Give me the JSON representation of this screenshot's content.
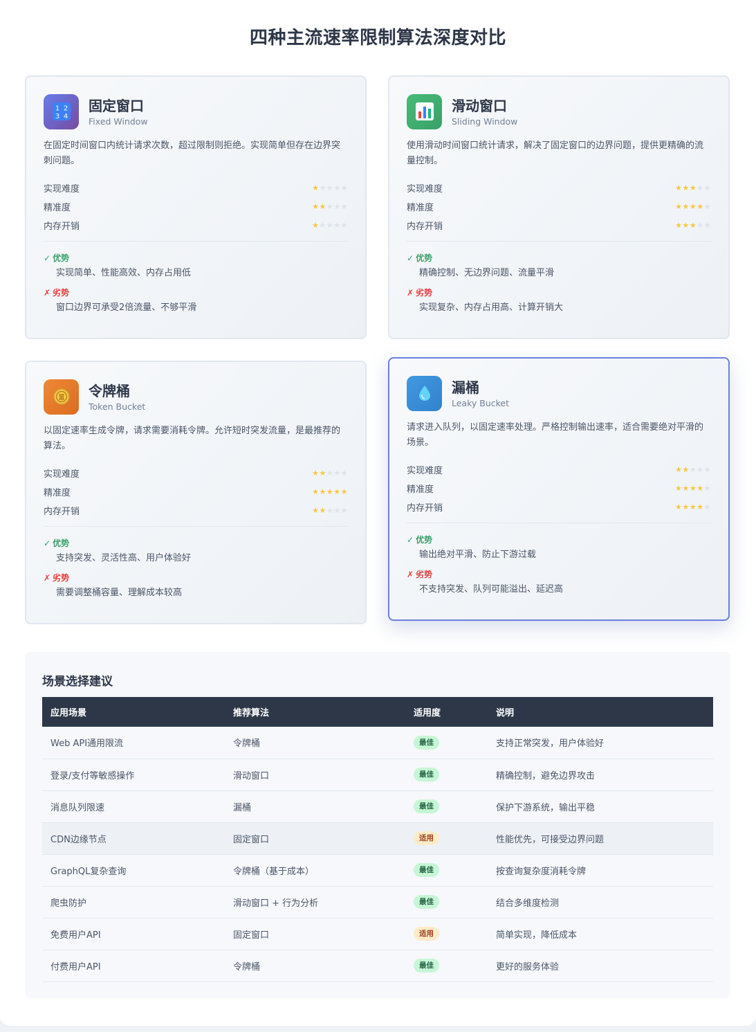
{
  "title": "四种主流速率限制算法深度对比",
  "metric_labels": [
    "实现难度",
    "精准度",
    "内存开销"
  ],
  "pros_label": "优势",
  "cons_label": "劣势",
  "pros_mark": "✓",
  "cons_mark": "✗",
  "cards": [
    {
      "name": "固定窗口",
      "en": "Fixed Window",
      "icon": "numbers-icon",
      "desc": "在固定时间窗口内统计请求次数，超过限制则拒绝。实现简单但存在边界突刺问题。",
      "ratings": [
        1,
        2,
        1
      ],
      "pros": "实现简单、性能高效、内存占用低",
      "cons": "窗口边界可承受2倍流量、不够平滑"
    },
    {
      "name": "滑动窗口",
      "en": "Sliding Window",
      "icon": "bar-chart-icon",
      "desc": "使用滑动时间窗口统计请求，解决了固定窗口的边界问题，提供更精确的流量控制。",
      "ratings": [
        3,
        4,
        3
      ],
      "pros": "精确控制、无边界问题、流量平滑",
      "cons": "实现复杂、内存占用高、计算开销大"
    },
    {
      "name": "令牌桶",
      "en": "Token Bucket",
      "icon": "coin-icon",
      "desc": "以固定速率生成令牌，请求需要消耗令牌。允许短时突发流量，是最推荐的算法。",
      "ratings": [
        2,
        5,
        2
      ],
      "pros": "支持突发、灵活性高、用户体验好",
      "cons": "需要调整桶容量、理解成本较高"
    },
    {
      "name": "漏桶",
      "en": "Leaky Bucket",
      "icon": "droplet-icon",
      "desc": "请求进入队列，以固定速率处理。严格控制输出速率，适合需要绝对平滑的场景。",
      "ratings": [
        2,
        4,
        4
      ],
      "pros": "输出绝对平滑、防止下游过载",
      "cons": "不支持突发、队列可能溢出、延迟高"
    }
  ],
  "scenario": {
    "title": "场景选择建议",
    "headers": [
      "应用场景",
      "推荐算法",
      "适用度",
      "说明"
    ],
    "rows": [
      {
        "scene": "Web API通用限流",
        "algo": "令牌桶",
        "fit": "最佳",
        "fit_type": "best",
        "note": "支持正常突发，用户体验好"
      },
      {
        "scene": "登录/支付等敏感操作",
        "algo": "滑动窗口",
        "fit": "最佳",
        "fit_type": "best",
        "note": "精确控制，避免边界攻击"
      },
      {
        "scene": "消息队列限速",
        "algo": "漏桶",
        "fit": "最佳",
        "fit_type": "best",
        "note": "保护下游系统，输出平稳"
      },
      {
        "scene": "CDN边缘节点",
        "algo": "固定窗口",
        "fit": "适用",
        "fit_type": "ok",
        "note": "性能优先，可接受边界问题"
      },
      {
        "scene": "GraphQL复杂查询",
        "algo": "令牌桶（基于成本）",
        "fit": "最佳",
        "fit_type": "best",
        "note": "按查询复杂度消耗令牌"
      },
      {
        "scene": "爬虫防护",
        "algo": "滑动窗口 + 行为分析",
        "fit": "最佳",
        "fit_type": "best",
        "note": "结合多维度检测"
      },
      {
        "scene": "免费用户API",
        "algo": "固定窗口",
        "fit": "适用",
        "fit_type": "ok",
        "note": "简单实现，降低成本"
      },
      {
        "scene": "付费用户API",
        "algo": "令牌桶",
        "fit": "最佳",
        "fit_type": "best",
        "note": "更好的服务体验"
      }
    ]
  },
  "colors": {
    "star_on": "#f6c744",
    "star_off": "#dde3eb",
    "best_badge": "#c6f6d5",
    "ok_badge": "#feebc8",
    "highlight_border": "#6b7fe0",
    "table_header": "#2d3748"
  }
}
